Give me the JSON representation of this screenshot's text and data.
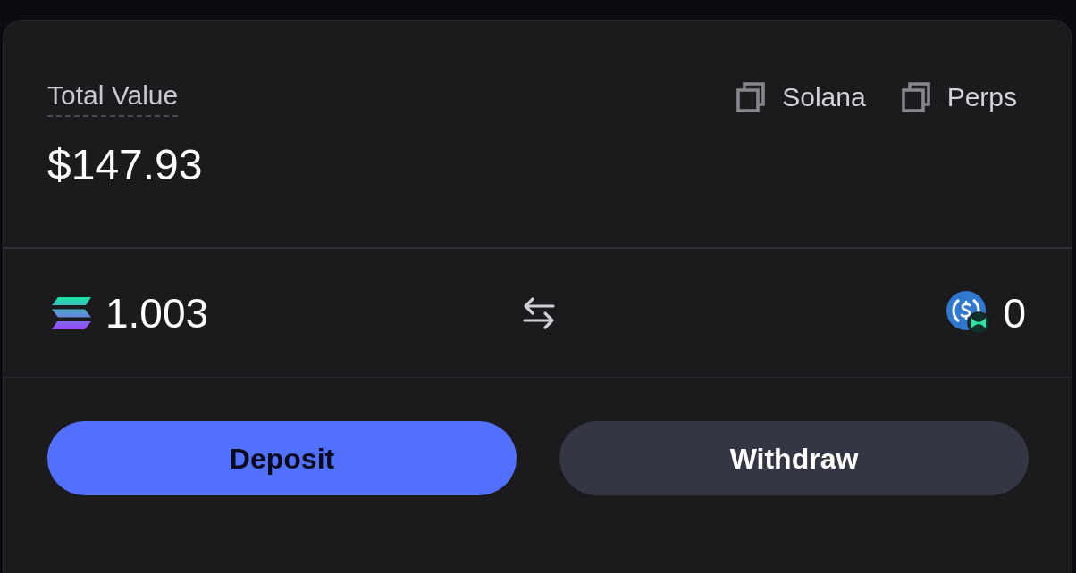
{
  "summary": {
    "label": "Total Value",
    "value": "$147.93",
    "copy_links": [
      {
        "label": "Solana"
      },
      {
        "label": "Perps"
      }
    ]
  },
  "balances": {
    "from": {
      "amount": "1.003"
    },
    "to": {
      "amount": "0"
    }
  },
  "buttons": [
    {
      "label": "Deposit",
      "kind": "primary"
    },
    {
      "label": "Withdraw",
      "kind": "secondary"
    }
  ]
}
